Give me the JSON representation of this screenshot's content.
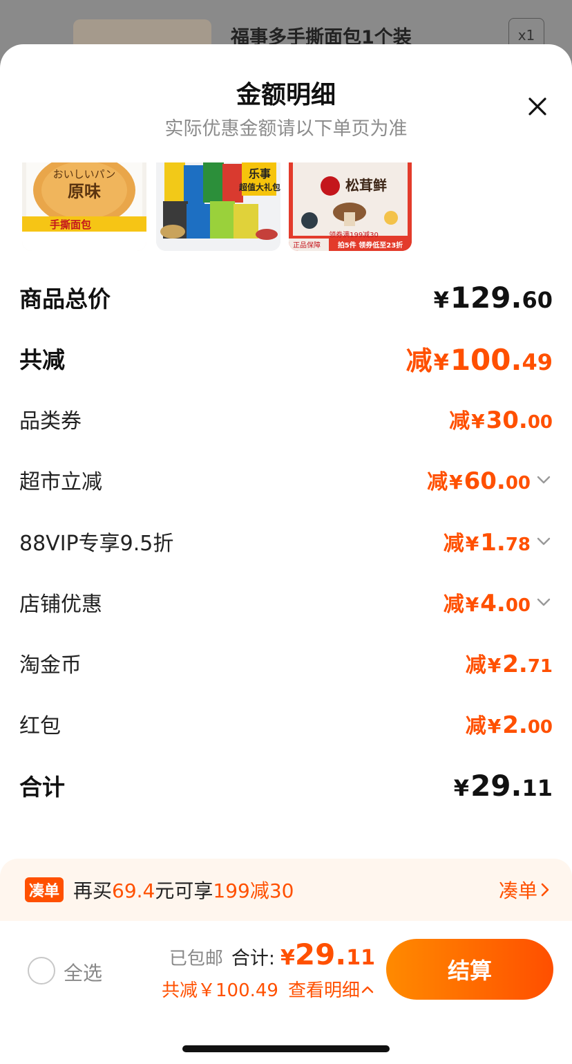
{
  "background": {
    "product_title": "福事多手撕面包1个装",
    "quantity": "x1"
  },
  "sheet": {
    "title": "金额明细",
    "subtitle": "实际优惠金额请以下单页为准",
    "close_icon": "close-icon"
  },
  "products": [
    {
      "name": "福事多手撕面包",
      "label_top": "おいしいパン",
      "label_main": "原味",
      "label_bottom": "手撕面包"
    },
    {
      "name": "乐事大礼包",
      "label_main": "乐事",
      "label_sub": "超值大礼包"
    },
    {
      "name": "松茸鲜",
      "label_main": "松茸鲜",
      "promo_1": "领券满199减30",
      "promo_2": "拍5件 领券低至23折",
      "badge": "正品保障"
    }
  ],
  "rows": [
    {
      "label": "商品总价",
      "prefix": "",
      "yen": "¥",
      "int": "129.",
      "dec": "60",
      "bold": true,
      "color": "black",
      "chevron": false
    },
    {
      "label": "共减",
      "prefix": "减",
      "yen": "¥",
      "int": "100.",
      "dec": "49",
      "bold": true,
      "color": "orange",
      "chevron": false
    },
    {
      "label": "品类券",
      "prefix": "减",
      "yen": "¥",
      "int": "30.",
      "dec": "00",
      "bold": false,
      "color": "orange",
      "chevron": false
    },
    {
      "label": "超市立减",
      "prefix": "减",
      "yen": "¥",
      "int": "60.",
      "dec": "00",
      "bold": false,
      "color": "orange",
      "chevron": true
    },
    {
      "label": "88VIP专享9.5折",
      "prefix": "减",
      "yen": "¥",
      "int": "1.",
      "dec": "78",
      "bold": false,
      "color": "orange",
      "chevron": true
    },
    {
      "label": "店铺优惠",
      "prefix": "减",
      "yen": "¥",
      "int": "4.",
      "dec": "00",
      "bold": false,
      "color": "orange",
      "chevron": true
    },
    {
      "label": "淘金币",
      "prefix": "减",
      "yen": "¥",
      "int": "2.",
      "dec": "71",
      "bold": false,
      "color": "orange",
      "chevron": false
    },
    {
      "label": "红包",
      "prefix": "减",
      "yen": "¥",
      "int": "2.",
      "dec": "00",
      "bold": false,
      "color": "orange",
      "chevron": false
    },
    {
      "label": "合计",
      "prefix": "",
      "yen": "¥",
      "int": "29.",
      "dec": "11",
      "bold": true,
      "color": "black",
      "chevron": false
    }
  ],
  "promo": {
    "tag": "凑单",
    "text_1": "再买",
    "amount": "69.4",
    "text_2": "元可享",
    "deal": "199减30",
    "link": "凑单"
  },
  "checkout": {
    "select_all": "全选",
    "shipping": "已包邮",
    "total_label": "合计:",
    "total_yen": "¥",
    "total_int": "29.",
    "total_dec": "11",
    "reduce_text": "共减￥100.49",
    "detail_link": "查看明细",
    "pay_button": "结算"
  },
  "colors": {
    "accent": "#ff5000",
    "button_gradient_start": "#ff8a00",
    "button_gradient_end": "#ff4f00",
    "promo_bg": "#fff6ee"
  }
}
